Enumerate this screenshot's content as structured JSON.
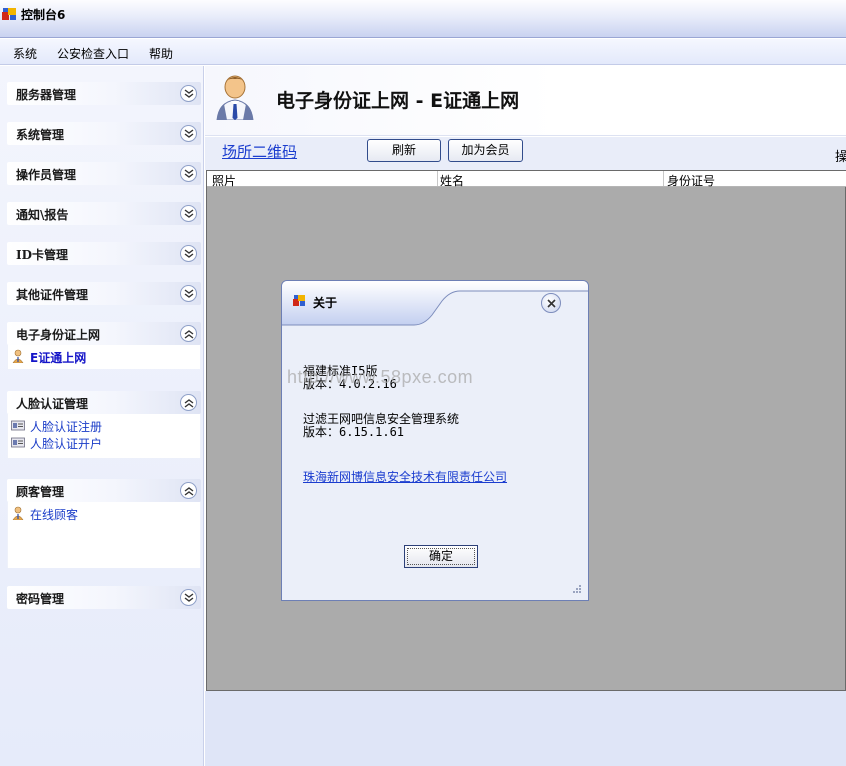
{
  "window": {
    "title": "控制台6"
  },
  "menu": {
    "items": [
      "系统",
      "公安检查入口",
      "帮助"
    ]
  },
  "sidebar": {
    "groups": [
      {
        "label": "服务器管理",
        "expanded": false
      },
      {
        "label": "系统管理",
        "expanded": false
      },
      {
        "label": "操作员管理",
        "expanded": false
      },
      {
        "label": "通知\\报告",
        "expanded": false
      },
      {
        "label": "ID卡管理",
        "expanded": false
      },
      {
        "label": "其他证件管理",
        "expanded": false
      },
      {
        "label": "电子身份证上网",
        "expanded": true,
        "items": [
          {
            "label": "E证通上网",
            "icon": "user-icon"
          }
        ]
      },
      {
        "label": "人脸认证管理",
        "expanded": true,
        "items": [
          {
            "label": "人脸认证注册",
            "icon": "id-card-icon"
          },
          {
            "label": "人脸认证开户",
            "icon": "id-card-icon"
          }
        ]
      },
      {
        "label": "顾客管理",
        "expanded": true,
        "items": [
          {
            "label": "在线顾客",
            "icon": "user-icon"
          }
        ]
      },
      {
        "label": "密码管理",
        "expanded": false
      }
    ]
  },
  "header": {
    "title": "电子身份证上网 - E证通上网"
  },
  "toolbar": {
    "qr_link": "场所二维码",
    "refresh_label": "刷新",
    "add_member_label": "加为会员",
    "cut_label": "操"
  },
  "table": {
    "columns": [
      "照片",
      "姓名",
      "身份证号"
    ]
  },
  "dialog": {
    "title": "关于",
    "watermark": "http://www.58pxe.com",
    "line1": "福建标准I5版",
    "line2": "版本：4.0.2.16",
    "line3": "过滤王网吧信息安全管理系统",
    "line4": "版本：6.15.1.61",
    "company_link": "珠海新网博信息安全技术有限责任公司",
    "ok_label": "确定"
  },
  "colors": {
    "accent": "#1c3ecf",
    "grid_bg": "#ababab",
    "sidebar_bg": "#e6ebfa"
  }
}
